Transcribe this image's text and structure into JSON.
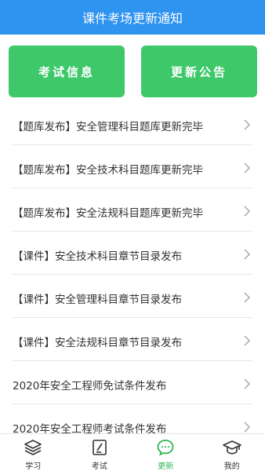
{
  "header": {
    "title": "课件考场更新通知"
  },
  "buttons": {
    "exam_info": "考试信息",
    "announcement": "更新公告"
  },
  "list": [
    "【题库发布】安全管理科目题库更新完毕",
    "【题库发布】安全技术科目题库更新完毕",
    "【题库发布】安全法规科目题库更新完毕",
    "【课件】安全技术科目章节目录发布",
    "【课件】安全管理科目章节目录发布",
    "【课件】安全法规科目章节目录发布",
    "2020年安全工程师免试条件发布",
    "2020年安全工程师考试条件发布"
  ],
  "tabs": [
    {
      "label": "学习",
      "icon": "layers-icon"
    },
    {
      "label": "考试",
      "icon": "exam-edit-icon"
    },
    {
      "label": "更新",
      "icon": "chat-bubble-icon",
      "active": true
    },
    {
      "label": "我的",
      "icon": "graduation-cap-icon"
    }
  ],
  "colors": {
    "header": "#2f93f0",
    "button": "#3ec86a",
    "active_tab": "#2bb84f"
  }
}
